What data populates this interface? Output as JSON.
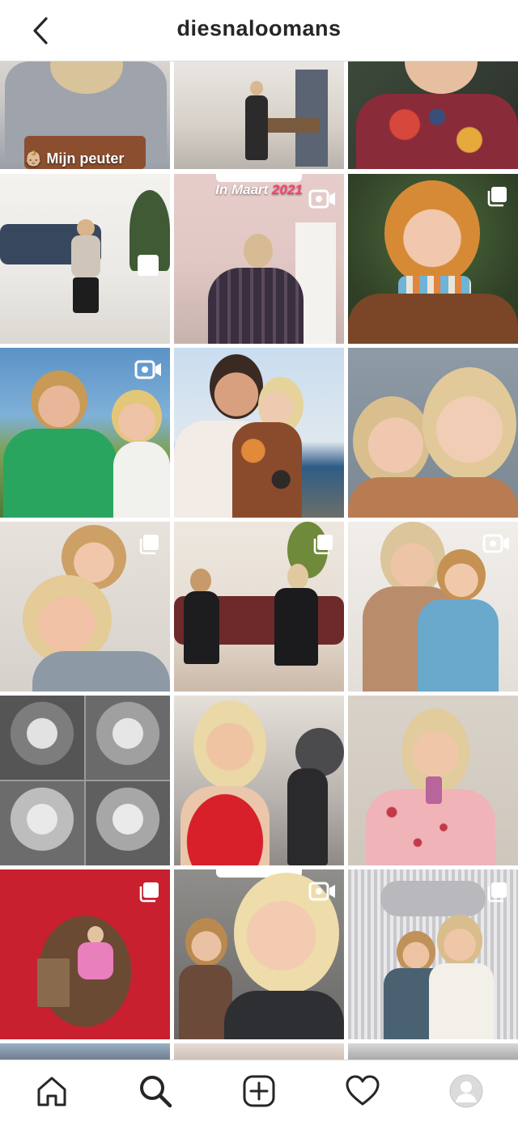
{
  "header": {
    "username": "diesnaloomans",
    "back_icon": "chevron-left-icon"
  },
  "colors": {
    "text": "#262626",
    "divider": "#dbdbdb",
    "accent_pink": "#ff3e6c"
  },
  "grid": {
    "columns": 3,
    "posts": [
      {
        "id": "post-1",
        "media": "image",
        "caption": "👶🏼 Mijn peuter"
      },
      {
        "id": "post-2",
        "media": "image"
      },
      {
        "id": "post-3",
        "media": "image"
      },
      {
        "id": "post-4",
        "media": "image"
      },
      {
        "id": "post-5",
        "media": "video",
        "overlay_text": "In Maart",
        "overlay_accent": "2021"
      },
      {
        "id": "post-6",
        "media": "carousel"
      },
      {
        "id": "post-7",
        "media": "video"
      },
      {
        "id": "post-8",
        "media": "image"
      },
      {
        "id": "post-9",
        "media": "image"
      },
      {
        "id": "post-10",
        "media": "carousel"
      },
      {
        "id": "post-11",
        "media": "carousel"
      },
      {
        "id": "post-12",
        "media": "video"
      },
      {
        "id": "post-13",
        "media": "image"
      },
      {
        "id": "post-14",
        "media": "image"
      },
      {
        "id": "post-15",
        "media": "image"
      },
      {
        "id": "post-16",
        "media": "carousel"
      },
      {
        "id": "post-17",
        "media": "video"
      },
      {
        "id": "post-18",
        "media": "carousel"
      }
    ]
  },
  "bottom_nav": {
    "items": [
      {
        "name": "home-icon"
      },
      {
        "name": "search-icon",
        "active": true
      },
      {
        "name": "new-post-icon"
      },
      {
        "name": "activity-heart-icon"
      },
      {
        "name": "profile-avatar"
      }
    ]
  }
}
